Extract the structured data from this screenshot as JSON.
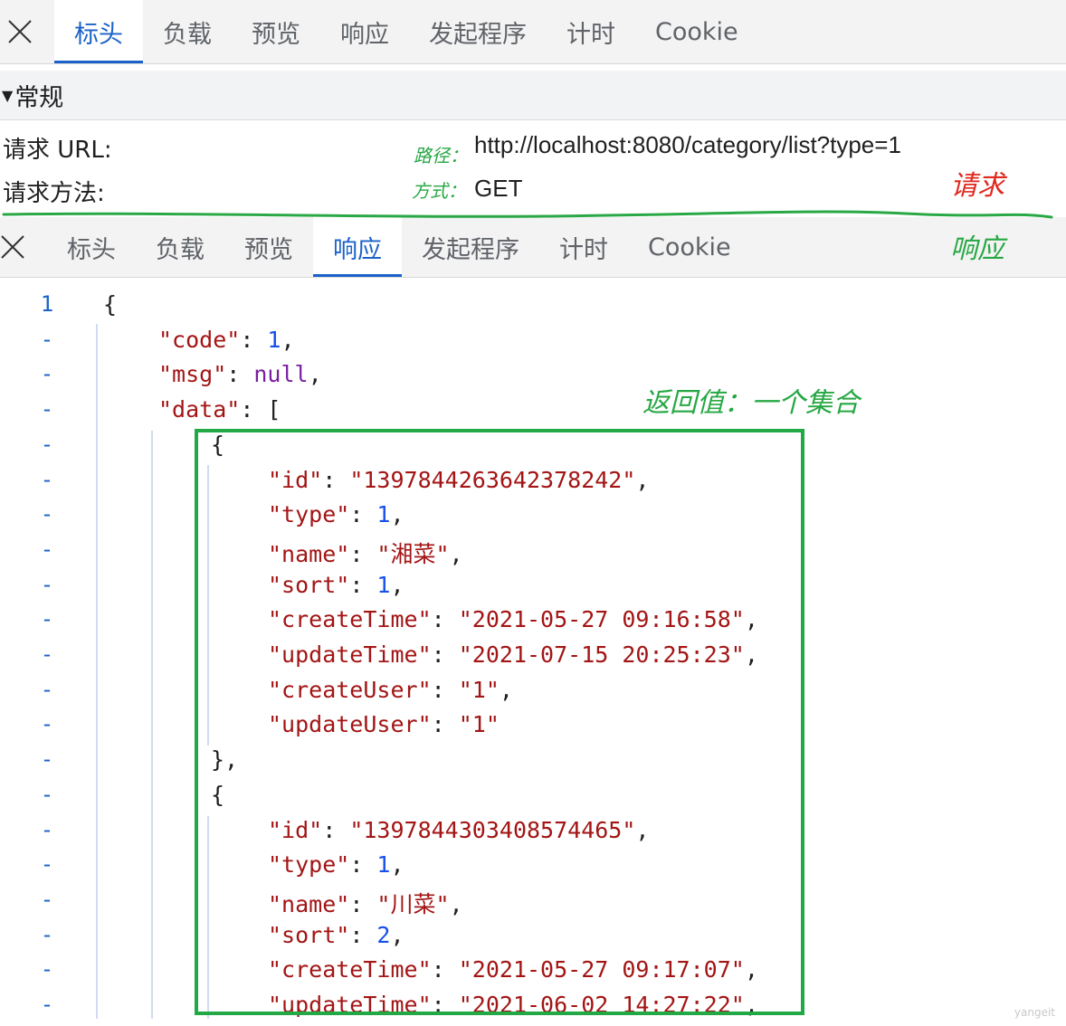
{
  "top_tabs": [
    "标头",
    "负载",
    "预览",
    "响应",
    "发起程序",
    "计时",
    "Cookie"
  ],
  "general_section": {
    "title": "常规"
  },
  "request": [
    {
      "label": "请求 URL:",
      "annotation": "路径：",
      "value": "http://localhost:8080/category/list?type=1"
    },
    {
      "label": "请求方法:",
      "annotation": "方式：",
      "value": "GET"
    }
  ],
  "annotations": {
    "request": "请求",
    "response": "响应",
    "return_value": "返回值：一个集合"
  },
  "bottom_tabs": [
    "标头",
    "负载",
    "预览",
    "响应",
    "发起程序",
    "计时",
    "Cookie"
  ],
  "gutter": [
    "1",
    "-",
    "-",
    "-",
    "-",
    "-",
    "-",
    "-",
    "-",
    "-",
    "-",
    "-",
    "-",
    "-",
    "-",
    "-",
    "-",
    "-",
    "-",
    "-",
    "-"
  ],
  "code_lines": [
    [
      {
        "c": "p",
        "t": "{"
      }
    ],
    [
      {
        "c": "k",
        "t": "\"code\""
      },
      {
        "c": "p",
        "t": ": "
      },
      {
        "c": "n",
        "t": "1"
      },
      {
        "c": "p",
        "t": ","
      }
    ],
    [
      {
        "c": "k",
        "t": "\"msg\""
      },
      {
        "c": "p",
        "t": ": "
      },
      {
        "c": "kw",
        "t": "null"
      },
      {
        "c": "p",
        "t": ","
      }
    ],
    [
      {
        "c": "k",
        "t": "\"data\""
      },
      {
        "c": "p",
        "t": ": ["
      }
    ],
    [
      {
        "c": "p",
        "t": "{"
      }
    ],
    [
      {
        "c": "k",
        "t": "\"id\""
      },
      {
        "c": "p",
        "t": ": "
      },
      {
        "c": "s",
        "t": "\"1397844263642378242\""
      },
      {
        "c": "p",
        "t": ","
      }
    ],
    [
      {
        "c": "k",
        "t": "\"type\""
      },
      {
        "c": "p",
        "t": ": "
      },
      {
        "c": "n",
        "t": "1"
      },
      {
        "c": "p",
        "t": ","
      }
    ],
    [
      {
        "c": "k",
        "t": "\"name\""
      },
      {
        "c": "p",
        "t": ": "
      },
      {
        "c": "s",
        "t": "\"湘菜\""
      },
      {
        "c": "p",
        "t": ","
      }
    ],
    [
      {
        "c": "k",
        "t": "\"sort\""
      },
      {
        "c": "p",
        "t": ": "
      },
      {
        "c": "n",
        "t": "1"
      },
      {
        "c": "p",
        "t": ","
      }
    ],
    [
      {
        "c": "k",
        "t": "\"createTime\""
      },
      {
        "c": "p",
        "t": ": "
      },
      {
        "c": "s",
        "t": "\"2021-05-27 09:16:58\""
      },
      {
        "c": "p",
        "t": ","
      }
    ],
    [
      {
        "c": "k",
        "t": "\"updateTime\""
      },
      {
        "c": "p",
        "t": ": "
      },
      {
        "c": "s",
        "t": "\"2021-07-15 20:25:23\""
      },
      {
        "c": "p",
        "t": ","
      }
    ],
    [
      {
        "c": "k",
        "t": "\"createUser\""
      },
      {
        "c": "p",
        "t": ": "
      },
      {
        "c": "s",
        "t": "\"1\""
      },
      {
        "c": "p",
        "t": ","
      }
    ],
    [
      {
        "c": "k",
        "t": "\"updateUser\""
      },
      {
        "c": "p",
        "t": ": "
      },
      {
        "c": "s",
        "t": "\"1\""
      }
    ],
    [
      {
        "c": "p",
        "t": "},"
      }
    ],
    [
      {
        "c": "p",
        "t": "{"
      }
    ],
    [
      {
        "c": "k",
        "t": "\"id\""
      },
      {
        "c": "p",
        "t": ": "
      },
      {
        "c": "s",
        "t": "\"1397844303408574465\""
      },
      {
        "c": "p",
        "t": ","
      }
    ],
    [
      {
        "c": "k",
        "t": "\"type\""
      },
      {
        "c": "p",
        "t": ": "
      },
      {
        "c": "n",
        "t": "1"
      },
      {
        "c": "p",
        "t": ","
      }
    ],
    [
      {
        "c": "k",
        "t": "\"name\""
      },
      {
        "c": "p",
        "t": ": "
      },
      {
        "c": "s",
        "t": "\"川菜\""
      },
      {
        "c": "p",
        "t": ","
      }
    ],
    [
      {
        "c": "k",
        "t": "\"sort\""
      },
      {
        "c": "p",
        "t": ": "
      },
      {
        "c": "n",
        "t": "2"
      },
      {
        "c": "p",
        "t": ","
      }
    ],
    [
      {
        "c": "k",
        "t": "\"createTime\""
      },
      {
        "c": "p",
        "t": ": "
      },
      {
        "c": "s",
        "t": "\"2021-05-27 09:17:07\""
      },
      {
        "c": "p",
        "t": ","
      }
    ],
    [
      {
        "c": "k",
        "t": "\"updateTime\""
      },
      {
        "c": "p",
        "t": ": "
      },
      {
        "c": "s",
        "t": "\"2021-06-02 14:27:22\""
      },
      {
        "c": "p",
        "t": ","
      }
    ]
  ],
  "watermark": "yangeit",
  "colors": {
    "accent": "#1a62c9",
    "annotation_green": "#27a844",
    "annotation_red": "#e0281e",
    "json_string": "#a31515",
    "json_number": "#1750eb"
  }
}
